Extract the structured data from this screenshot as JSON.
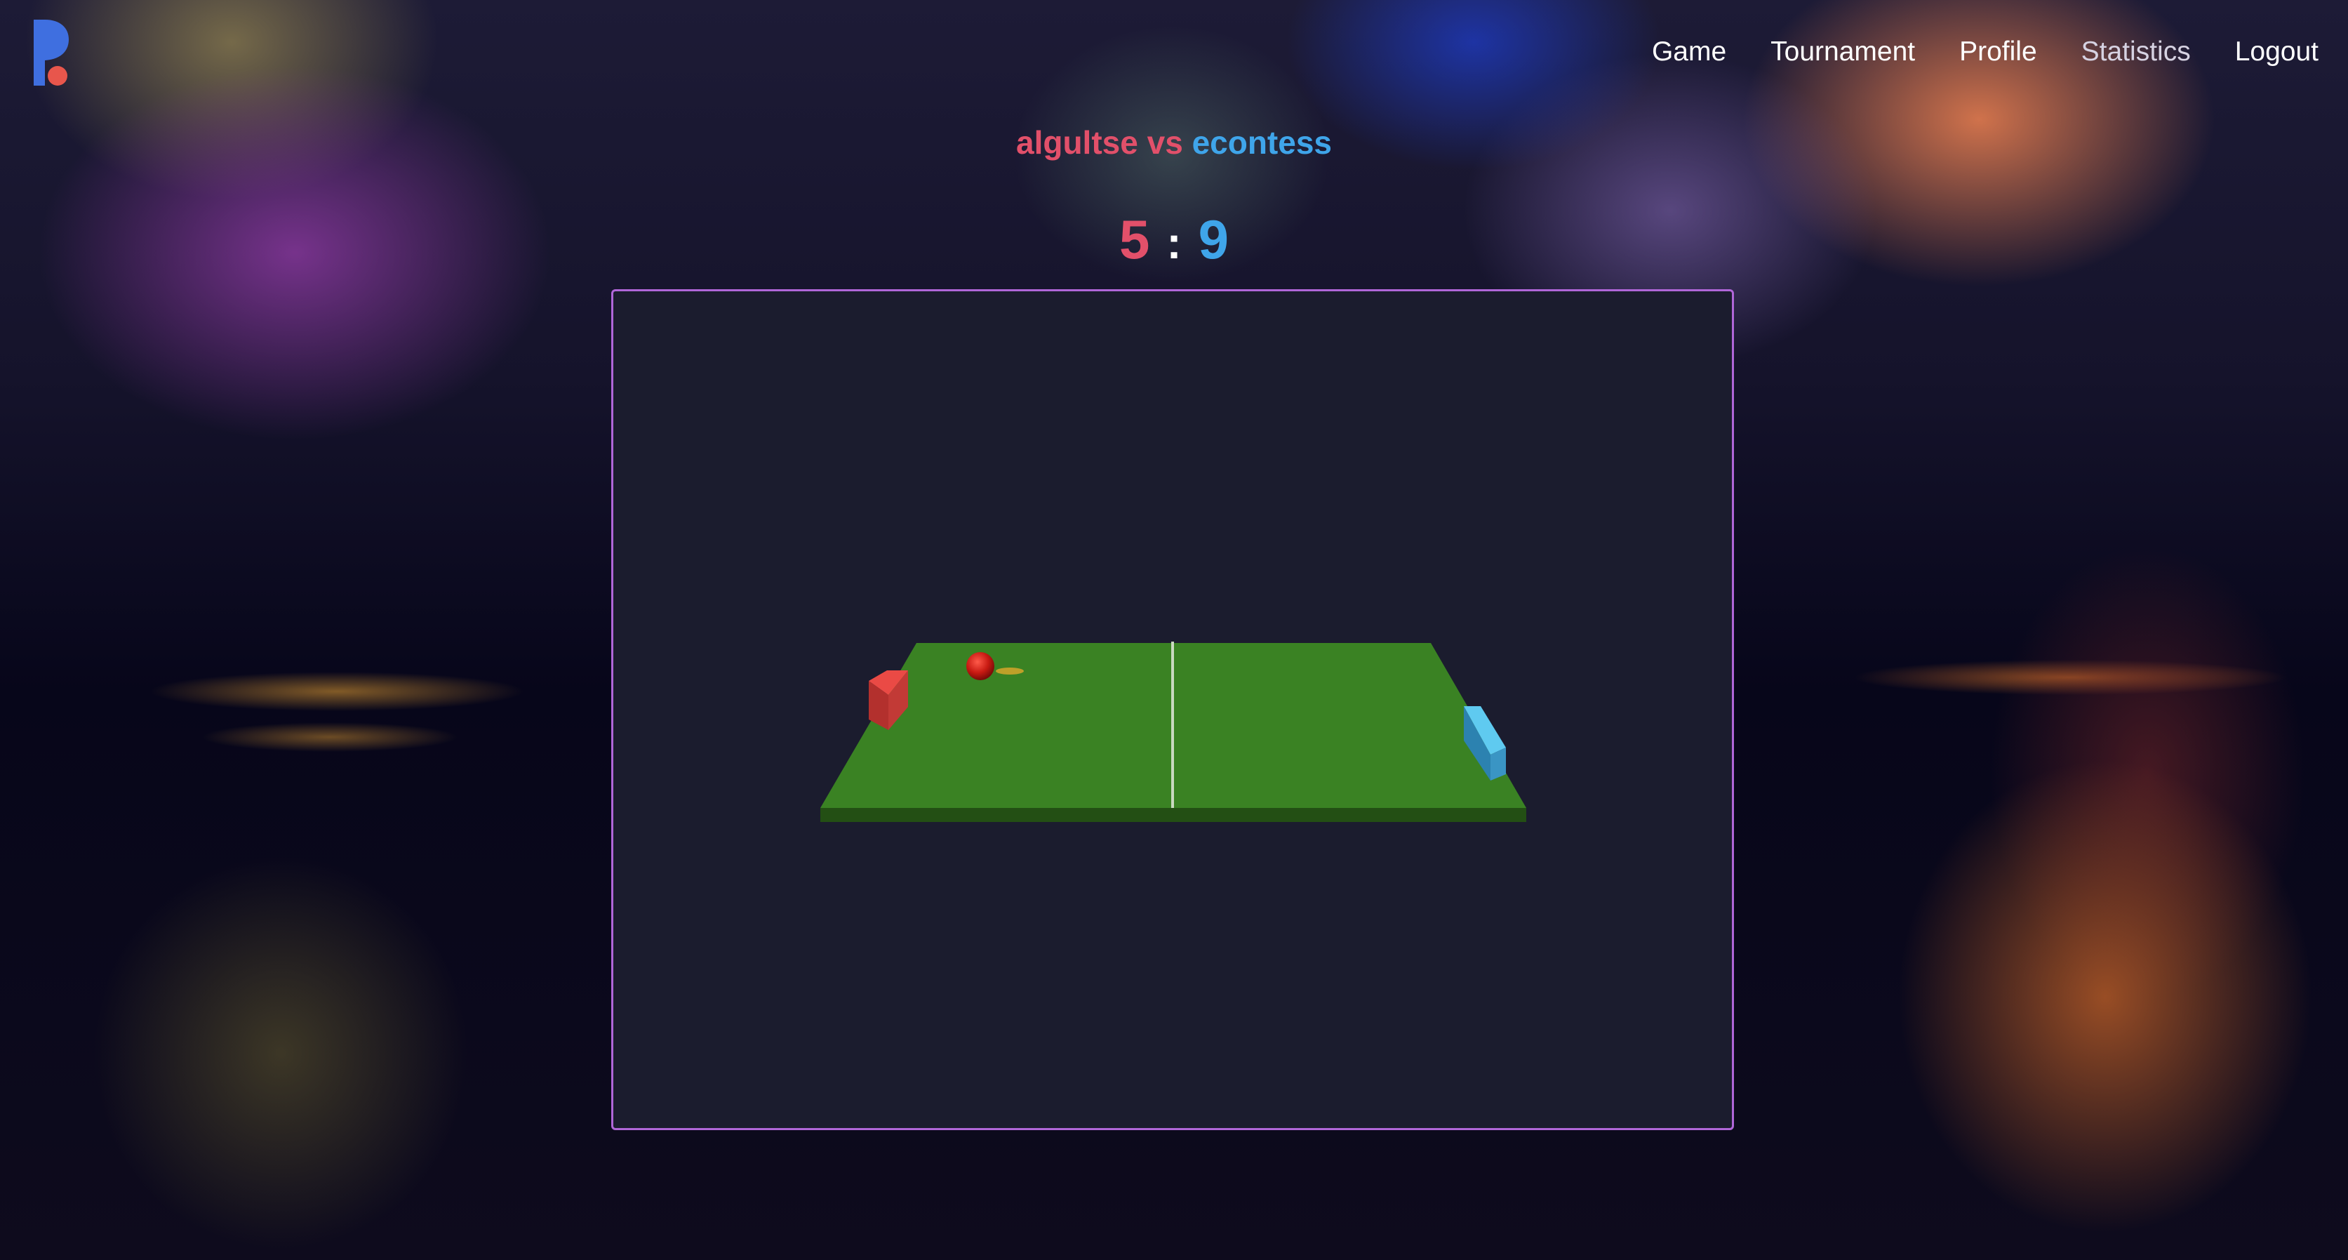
{
  "nav": {
    "links": [
      "Game",
      "Tournament",
      "Profile",
      "Statistics",
      "Logout"
    ]
  },
  "match": {
    "player1": "algultse",
    "vs": "vs",
    "player2": "econtess",
    "score1": "5",
    "separator": ":",
    "score2": "9"
  },
  "colors": {
    "player1": "#e2506a",
    "player2": "#3fa5ea",
    "table": "#3a8223",
    "canvas_border": "#b066d8",
    "logo_blue": "#3f6fe0",
    "logo_dot": "#e8564c"
  },
  "icons": {
    "logo": "app-logo-icon"
  }
}
